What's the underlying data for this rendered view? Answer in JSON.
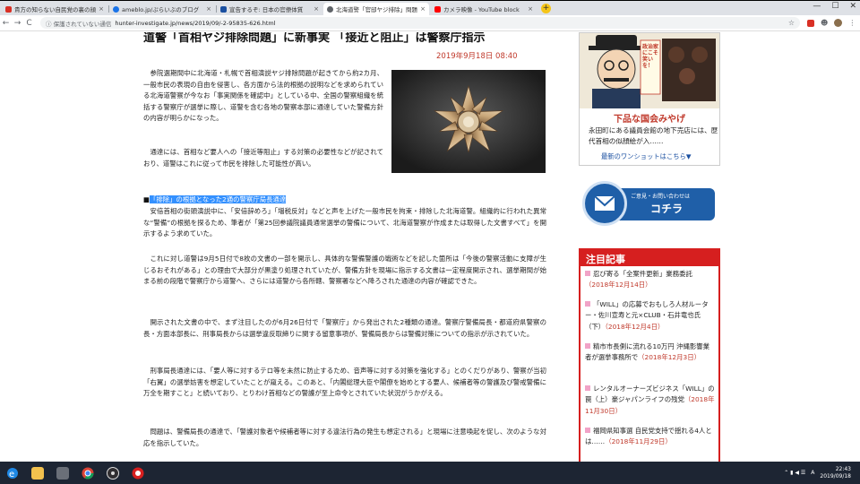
{
  "browser": {
    "tabs": [
      {
        "label": "貴方の知らない自民党の裏の顔",
        "color": "#d93025",
        "active": false
      },
      {
        "label": "ameblo.jp/ぷらいぶのブログ",
        "color": "#1a73e8",
        "active": false
      },
      {
        "label": "宣告するぞ: 日本の官僚体質",
        "color": "#1a4fa0",
        "active": false
      },
      {
        "label": "北海道警「官邸ヤジ排除」問題で新事実",
        "color": "#5f6368",
        "active": true
      },
      {
        "label": "カメラ映像 - YouTube block",
        "color": "#ff0000",
        "active": false
      }
    ],
    "tab_close": "×",
    "new_tab": "+",
    "controls": {
      "minimize": "—",
      "maximize": "☐",
      "close": "✕"
    },
    "nav": {
      "back": "←",
      "forward": "→",
      "reload": "C"
    },
    "address": {
      "insecure_label": "ⓘ 保護されていない通信",
      "url": "hunter-investigate.jp/news/2019/09/-2-95835-626.html"
    },
    "bookmark": "☆",
    "toolbar_icons": {
      "account": "☻",
      "menu": "⋮"
    }
  },
  "article": {
    "title": "道警「首相ヤジ排除問題」に新事実 「接近と阻止」は警察庁指示",
    "date": "2019年9月18日 08:40",
    "paragraphs": [
      "　参院選期間中に北海道・札幌で首相演説ヤジ排除問題が起きてから約2カ月、一般市民の表現の自由を侵害し、各方面から法的根拠の説明などを求められている北海道警察が今なお「事実関係を確認中」としている中、全国の警察組織を統括する警察庁が選挙に際し、道警を含む各地の警察本部に通達していた警備方針の内容が明らかになった。",
      "　通達には、首相など要人への「接近等阻止」する対策の必要性などが記されており、道警はこれに従って市民を排除した可能性が高い。"
    ],
    "highlight_heading": "「排除」の根拠となった2通の警察庁局長通達",
    "body": [
      "　安倍首相の街頭演説中に、「安倍辞めろ」「増税反対」などと声を上げた一般市民を拘束・排除した北海道警。組織的に行われた異常な“警備”の根拠を探るため、筆者が「第25回参議院議員通常選挙の警備について、北海道警察が作成または取得した文書すべて」を開示するよう求めていた。",
      "　これに対し道警は9月5日付で8枚の文書の一部を開示し、具体的な警備警護の戦術などを記した箇所は「今後の警察活動に支障が生じるおそれがある」との理由で大部分が黒塗り処理されていたが、警備方針を現場に指示する文書は一定程度開示され、選挙期間が始まる前の段階で警察庁から道警へ、さらには道警から各所轄、警察署などへ降ろされた通達の内容が確認できた。",
      "　開示された文書の中で、まず注目したのが6月26日付で「警察庁」から発出された2種類の通達。警察庁警備局長・都道府県警察の長・方面本部長に、刑事局長からは選挙違反取締りに関する留意事項が、警備局長からは警備対策についての指示が示されていた。",
      "　刑事局長通達には、「要人等に対するテロ等を未然に防止するため、音声等に対する対策を強化する」とのくだりがあり、警察が当初「右翼」の選挙妨害を想定していたことが窺える。このあと、「内閣総理大臣や閣僚を始めとする要人、候補者等の警護及び警戒警備に万全を期すこと」と続いており、とりわけ首相などの警護が至上命令とされていた状況がうかがえる。",
      "　問題は、警備局長の通達で、「警護対象者や候補者等に対する違法行為の発生も想定される」と現場に注意喚起を促し、次のような対応を指示していた。"
    ]
  },
  "sidebar": {
    "ad_title": "下品な国会みやげ",
    "ad_text": "永田町にある議員会館の地下売店には、歴代首相の似顔絵が入……",
    "ad_link": "最新のワンショットはこちら▼",
    "ad_caption": "政治家にこそ笑いを！",
    "contact_small": "ご意見・お問い合わせは",
    "contact_big": "コチラ",
    "notice_heading": "注目記事",
    "notices": [
      {
        "text": "忍び寄る「全案件更新」業務委託",
        "date": "（2018年12月14日）"
      },
      {
        "text": "「WILL」の応募でおもしろ人材ルーター・佐川宣寿と元×CLUB・石井竜也氏（下）",
        "date": "（2018年12月4日）"
      },
      {
        "text": "精市市長側に流れる10万円 沖縄影響業者が選挙事務所で",
        "date": "（2018年12月3日）"
      },
      {
        "text": "レンタルオーナーズビジネス「WILL」の罠（上）豪ジャパンライフの残党",
        "date": "（2018年11月30日）"
      },
      {
        "text": "福岡県知事選 自民党支持で揺れる4人とは……",
        "date": "（2018年11月29日）"
      }
    ]
  },
  "taskbar": {
    "time": "22:43",
    "date": "2019/09/18",
    "lang": "A",
    "tray": "⌃ ▮ ◀ ☰"
  }
}
